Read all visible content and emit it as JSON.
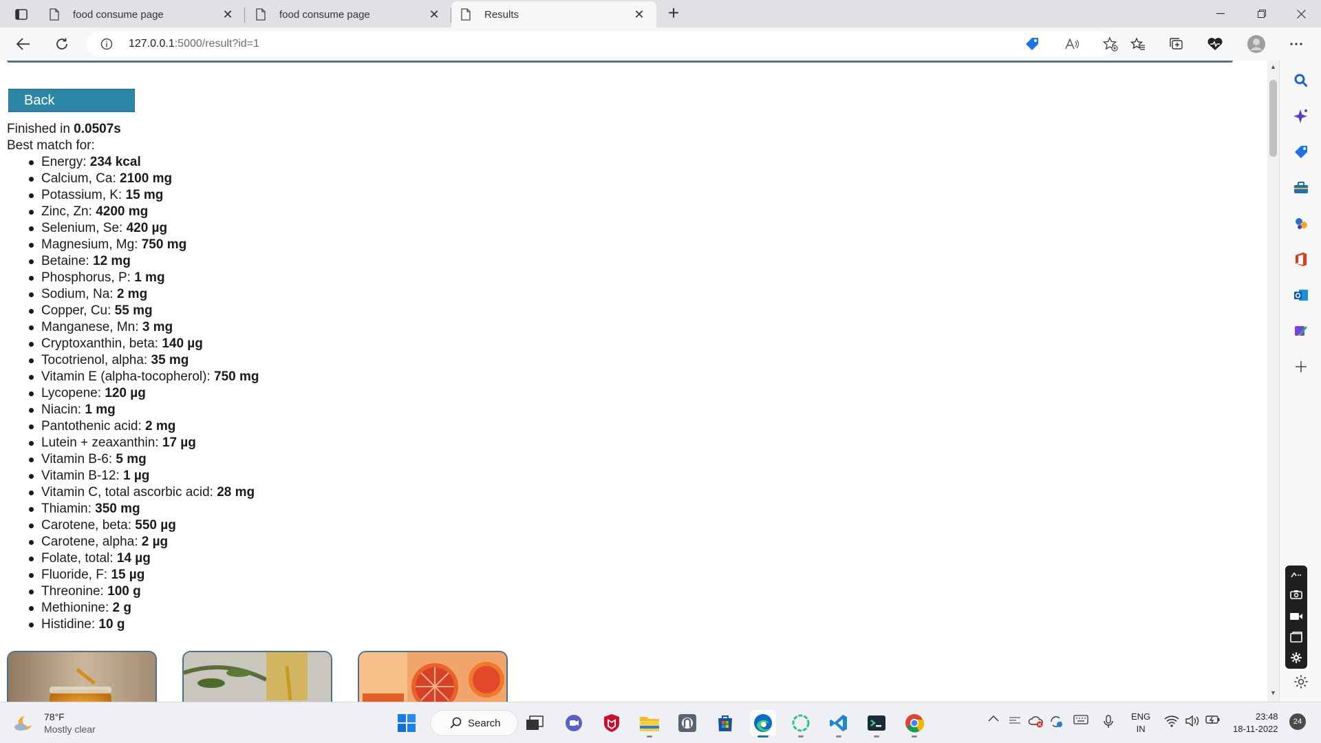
{
  "browser": {
    "tabs": [
      {
        "title": "food consume page",
        "active": false
      },
      {
        "title": "food consume page",
        "active": false
      },
      {
        "title": "Results",
        "active": true
      }
    ],
    "url_host": "127.0.0.1",
    "url_path": ":5000/result?id=1"
  },
  "page": {
    "back_label": "Back",
    "finished_prefix": "Finished in ",
    "finished_time": "0.0507s",
    "best_match_label": "Best match for:",
    "nutrients": [
      {
        "name": "Energy: ",
        "value": "234 kcal"
      },
      {
        "name": "Calcium, Ca: ",
        "value": "2100 mg"
      },
      {
        "name": "Potassium, K: ",
        "value": "15 mg"
      },
      {
        "name": "Zinc, Zn: ",
        "value": "4200 mg"
      },
      {
        "name": "Selenium, Se: ",
        "value": "420 µg"
      },
      {
        "name": "Magnesium, Mg: ",
        "value": "750 mg"
      },
      {
        "name": "Betaine: ",
        "value": "12 mg"
      },
      {
        "name": "Phosphorus, P: ",
        "value": "1 mg"
      },
      {
        "name": "Sodium, Na: ",
        "value": "2 mg"
      },
      {
        "name": "Copper, Cu: ",
        "value": "55 mg"
      },
      {
        "name": "Manganese, Mn: ",
        "value": "3 mg"
      },
      {
        "name": "Cryptoxanthin, beta: ",
        "value": "140 µg"
      },
      {
        "name": "Tocotrienol, alpha: ",
        "value": "35 mg"
      },
      {
        "name": "Vitamin E (alpha-tocopherol): ",
        "value": "750 mg"
      },
      {
        "name": "Lycopene: ",
        "value": "120 µg"
      },
      {
        "name": "Niacin: ",
        "value": "1 mg"
      },
      {
        "name": "Pantothenic acid: ",
        "value": "2 mg"
      },
      {
        "name": "Lutein + zeaxanthin: ",
        "value": "17 µg"
      },
      {
        "name": "Vitamin B-6: ",
        "value": "5 mg"
      },
      {
        "name": "Vitamin B-12: ",
        "value": "1 µg"
      },
      {
        "name": "Vitamin C, total ascorbic acid: ",
        "value": "28 mg"
      },
      {
        "name": "Thiamin: ",
        "value": "350 mg"
      },
      {
        "name": "Carotene, beta: ",
        "value": "550 µg"
      },
      {
        "name": "Carotene, alpha: ",
        "value": "2 µg"
      },
      {
        "name": "Folate, total: ",
        "value": "14 µg"
      },
      {
        "name": "Fluoride, F: ",
        "value": "15 µg"
      },
      {
        "name": "Threonine: ",
        "value": "100 g"
      },
      {
        "name": "Methionine: ",
        "value": "2 g"
      },
      {
        "name": "Histidine: ",
        "value": "10 g"
      }
    ],
    "food_images": [
      "honey-jar-image",
      "olive-oil-image",
      "blood-orange-image"
    ]
  },
  "taskbar": {
    "weather_temp": "78°F",
    "weather_cond": "Mostly clear",
    "search_label": "Search",
    "lang_line1": "ENG",
    "lang_line2": "IN",
    "time": "23:48",
    "date": "18-11-2022",
    "notification_count": "24"
  },
  "colors": {
    "back_button": "#2e86a6",
    "tab_strip": "#dfe1e5",
    "toolbar": "#f7f7f7"
  }
}
